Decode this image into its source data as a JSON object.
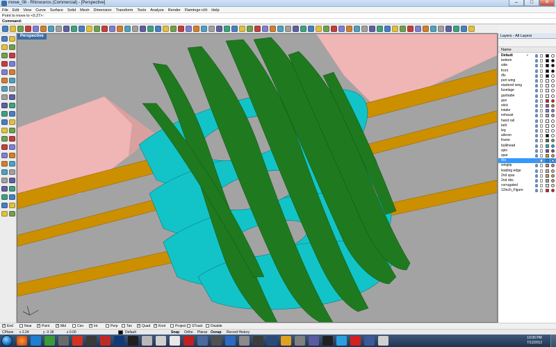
{
  "window": {
    "title": "mowe_08 - Rhinoceros (Commercial) - [Perspective]",
    "minimize": "–",
    "maximize": "□",
    "close": "✕"
  },
  "menu": [
    "File",
    "Edit",
    "View",
    "Curve",
    "Surface",
    "Solid",
    "Mesh",
    "Dimension",
    "Transform",
    "Tools",
    "Analyze",
    "Render",
    "Flamingo nXt",
    "Help"
  ],
  "command": {
    "history": "Point to move to <0.27>:",
    "prompt_label": "Command:",
    "value": ""
  },
  "viewport": {
    "label": "Perspective"
  },
  "layers_panel": {
    "header": "Layers - All Layers",
    "column_name": "Name",
    "layers": [
      {
        "name": "Default",
        "current": true,
        "color": "#000000",
        "mat": "#ffffff"
      },
      {
        "name": "bottom",
        "color": "#000000",
        "mat": "#000000"
      },
      {
        "name": "side",
        "color": "#000000",
        "mat": "#000000"
      },
      {
        "name": "front",
        "color": "#000000",
        "mat": "#000000"
      },
      {
        "name": "rfls",
        "color": "#000000",
        "mat": "#ffffff"
      },
      {
        "name": "port wing",
        "color": "#ffffff",
        "mat": "#ffffff"
      },
      {
        "name": "starbord wing",
        "color": "#ffffff",
        "mat": "#ffffff"
      },
      {
        "name": "fuselage",
        "color": "#ffffff",
        "mat": "#ffffff"
      },
      {
        "name": "gunbabe",
        "color": "#ffffff",
        "mat": "#ffffff"
      },
      {
        "name": "gun",
        "color": "#e31a1a",
        "mat": "#e31a1a"
      },
      {
        "name": "stick",
        "color": "#a040c8",
        "mat": "#d47a1a"
      },
      {
        "name": "intake",
        "color": "#7f7fd0",
        "mat": "#7f7fd0"
      },
      {
        "name": "exhaust",
        "color": "#b09ac8",
        "mat": "#b09ac8"
      },
      {
        "name": "hand rail",
        "color": "#ffffff",
        "mat": "#ffffff"
      },
      {
        "name": "belt",
        "color": "#ffffff",
        "mat": "#ffffff"
      },
      {
        "name": "leg",
        "color": "#ffffff",
        "mat": "#ffffff"
      },
      {
        "name": "aileron",
        "color": "#000000",
        "mat": "#ffffff"
      },
      {
        "name": "frame",
        "color": "#2e7d32",
        "mat": "#4caf50"
      },
      {
        "name": "bulkhead",
        "color": "#00bcd4",
        "mat": "#00bcd4"
      },
      {
        "name": "spin",
        "color": "#7a3fb0",
        "mat": "#7a3fb0"
      },
      {
        "name": "spar",
        "color": "#d4a017",
        "mat": "#d4a017"
      },
      {
        "name": "rbs",
        "color": "#1e8fff",
        "mat": "#9ec9ff",
        "selected": true
      },
      {
        "name": "wingtip",
        "color": "#c08080",
        "mat": "#c08080"
      },
      {
        "name": "leading edge",
        "color": "#d2b48c",
        "mat": "#d2b48c"
      },
      {
        "name": "2nd spar",
        "color": "#c0a060",
        "mat": "#c0a060"
      },
      {
        "name": "2nd ribs",
        "color": "#b8a080",
        "mat": "#b8a080"
      },
      {
        "name": "corrugated",
        "color": "#e0e0e0",
        "mat": "#e0e0e0"
      },
      {
        "name": "12inch_Figure",
        "color": "#e31a1a",
        "mat": "#e31a1a"
      }
    ]
  },
  "osnap": [
    {
      "label": "End",
      "checked": true
    },
    {
      "label": "Near",
      "checked": false
    },
    {
      "label": "Point",
      "checked": true
    },
    {
      "label": "Mid",
      "checked": true
    },
    {
      "label": "Cen",
      "checked": false
    },
    {
      "label": "Int",
      "checked": true
    },
    {
      "label": "Perp",
      "checked": false
    },
    {
      "label": "Tan",
      "checked": false
    },
    {
      "label": "Quad",
      "checked": true
    },
    {
      "label": "Knot",
      "checked": true
    },
    {
      "label": "Project",
      "checked": false
    },
    {
      "label": "STrack",
      "checked": false
    },
    {
      "label": "Disable",
      "checked": false
    }
  ],
  "status": {
    "cplane": "CPlane",
    "x": "x 2.24",
    "y": "y -3.18",
    "z": "z 0.00",
    "layer": "Default",
    "snap": "Snap",
    "ortho": "Ortho",
    "planar": "Planar",
    "osnap": "Osnap",
    "record_history": "Record History"
  },
  "taskbar": {
    "time": "10:00 PM",
    "date": "7/12/2012"
  },
  "colors": {
    "ribs": "#12c4c8",
    "frames": "#1f7a1f",
    "spars": "#cc8f00",
    "pink": "#f0b5b5",
    "viewport_bg": "#a3a3a3"
  }
}
